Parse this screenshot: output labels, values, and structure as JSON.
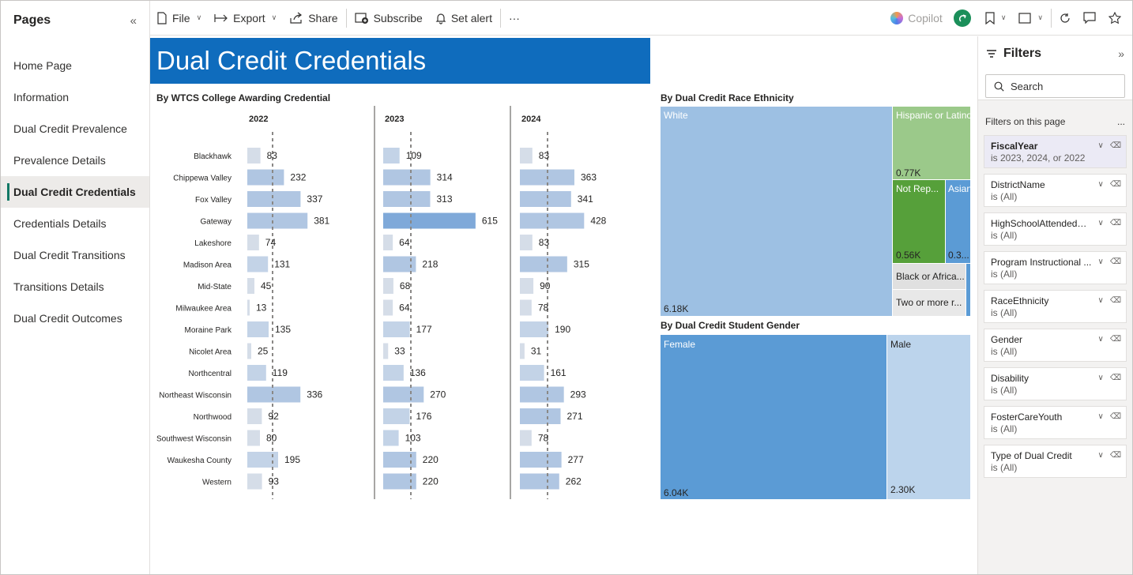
{
  "pages": {
    "title": "Pages",
    "items": [
      {
        "label": "Home Page"
      },
      {
        "label": "Information"
      },
      {
        "label": "Dual Credit Prevalence"
      },
      {
        "label": "Prevalence Details"
      },
      {
        "label": "Dual Credit Credentials",
        "active": true
      },
      {
        "label": "Credentials Details"
      },
      {
        "label": "Dual Credit Transitions"
      },
      {
        "label": "Transitions Details"
      },
      {
        "label": "Dual Credit Outcomes"
      }
    ]
  },
  "toolbar": {
    "file": "File",
    "export": "Export",
    "share": "Share",
    "subscribe": "Subscribe",
    "set_alert": "Set alert",
    "more": "···",
    "copilot": "Copilot"
  },
  "report": {
    "title": "Dual Credit Credentials",
    "college_chart_title": "By WTCS College Awarding Credential",
    "race_chart_title": "By Dual Credit Race Ethnicity",
    "gender_chart_title": "By Dual Credit Student Gender"
  },
  "chart_data": [
    {
      "type": "bar",
      "orientation": "horizontal",
      "title": "By WTCS College Awarding Credential",
      "categories": [
        "Blackhawk",
        "Chippewa Valley",
        "Fox Valley",
        "Gateway",
        "Lakeshore",
        "Madison Area",
        "Mid-State",
        "Milwaukee Area",
        "Moraine Park",
        "Nicolet Area",
        "Northcentral",
        "Northeast Wisconsin",
        "Northwood",
        "Southwest Wisconsin",
        "Waukesha County",
        "Western"
      ],
      "series": [
        {
          "name": "2022",
          "values": [
            83,
            232,
            337,
            381,
            74,
            131,
            45,
            13,
            135,
            25,
            119,
            336,
            92,
            80,
            195,
            93
          ]
        },
        {
          "name": "2023",
          "values": [
            109,
            314,
            313,
            615,
            64,
            218,
            68,
            64,
            177,
            33,
            136,
            270,
            176,
            103,
            220,
            220
          ]
        },
        {
          "name": "2024",
          "values": [
            83,
            363,
            341,
            428,
            83,
            315,
            90,
            78,
            190,
            31,
            161,
            293,
            271,
            78,
            277,
            262
          ]
        }
      ],
      "xlim": [
        0,
        700
      ],
      "colors": {
        "low": "#d5dde8",
        "mid": "#b3c8e3",
        "high": "#7fa9d9"
      }
    },
    {
      "type": "treemap",
      "title": "By Dual Credit Race Ethnicity",
      "items": [
        {
          "label": "White",
          "value_label": "6.18K",
          "color": "#9dc0e3"
        },
        {
          "label": "Hispanic or Latino",
          "value_label": "0.77K",
          "color": "#9bc98a"
        },
        {
          "label": "Not Rep...",
          "value_label": "0.56K",
          "color": "#56a03a"
        },
        {
          "label": "Asian",
          "value_label": "0.3...",
          "color": "#5b9bd5"
        },
        {
          "label": "Black or Africa...",
          "value_label": "",
          "color": "#e0e0e0"
        },
        {
          "label": "Two or more r...",
          "value_label": "",
          "color": "#e8e8e8"
        }
      ]
    },
    {
      "type": "treemap",
      "title": "By Dual Credit Student Gender",
      "items": [
        {
          "label": "Female",
          "value_label": "6.04K",
          "color": "#5b9bd5"
        },
        {
          "label": "Male",
          "value_label": "2.30K",
          "color": "#bcd4ec"
        }
      ]
    }
  ],
  "filters": {
    "title": "Filters",
    "search_placeholder": "Search",
    "section_label": "Filters on this page",
    "section_more": "...",
    "items": [
      {
        "name": "FiscalYear",
        "value": "is 2023, 2024, or 2022",
        "selected": true
      },
      {
        "name": "DistrictName",
        "value": "is (All)"
      },
      {
        "name": "HighSchoolAttendedN...",
        "value": "is (All)"
      },
      {
        "name": "Program Instructional ...",
        "value": "is (All)"
      },
      {
        "name": "RaceEthnicity",
        "value": "is (All)"
      },
      {
        "name": "Gender",
        "value": "is (All)"
      },
      {
        "name": "Disability",
        "value": "is (All)"
      },
      {
        "name": "FosterCareYouth",
        "value": "is (All)"
      },
      {
        "name": "Type of Dual Credit",
        "value": "is (All)"
      }
    ]
  }
}
